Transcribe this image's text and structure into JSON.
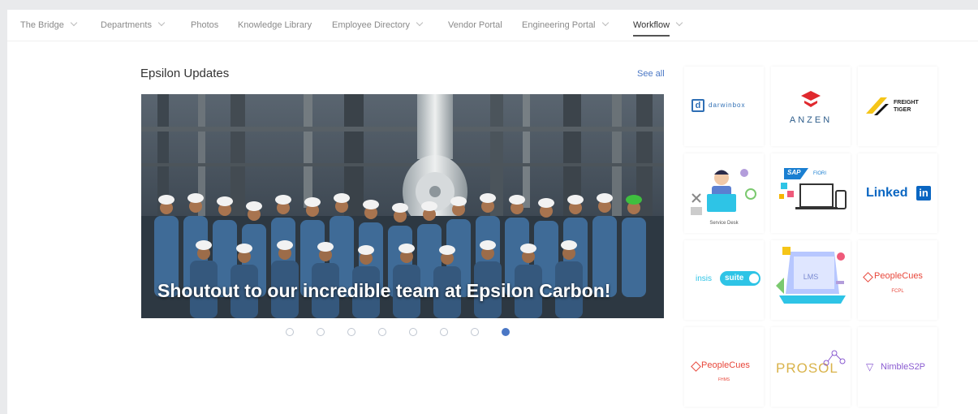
{
  "nav": {
    "items": [
      {
        "label": "The Bridge",
        "dropdown": true
      },
      {
        "label": "Departments",
        "dropdown": true
      },
      {
        "label": "Photos",
        "dropdown": false
      },
      {
        "label": "Knowledge Library",
        "dropdown": false
      },
      {
        "label": "Employee Directory",
        "dropdown": true
      },
      {
        "label": "Vendor Portal",
        "dropdown": false
      },
      {
        "label": "Engineering Portal",
        "dropdown": true
      },
      {
        "label": "Workflow",
        "dropdown": true,
        "active": true
      }
    ]
  },
  "updates": {
    "title": "Epsilon Updates",
    "see_all": "See all",
    "caption": "Shoutout to our incredible team at Epsilon Carbon!",
    "slide_count": 8,
    "active_slide": 8
  },
  "apps": {
    "darwinbox": {
      "mark": "d",
      "name": "darwinbox",
      "color": "#2f6fb5"
    },
    "anzen": {
      "name": "ANZEN",
      "color": "#e0292e"
    },
    "freight_tiger": {
      "line1": "FREIGHT",
      "line2": "TIGER",
      "color": "#f5c518"
    },
    "service_desk": {
      "label": "Service Desk"
    },
    "sap_fiori": {
      "brand": "SAP",
      "product": "FIORI",
      "color": "#1a7fd1"
    },
    "linkedin": {
      "word": "Linked",
      "mark": "in",
      "color": "#0a66c2"
    },
    "insis": {
      "word": "insis",
      "suite": "suite"
    },
    "lms": {
      "label": "LMS"
    },
    "peoplecues_fcpl": {
      "name": "PeopleCues",
      "sub": "FCPL",
      "color": "#e8473b"
    },
    "peoplecues_2": {
      "name": "PeopleCues",
      "sub": "FHMS",
      "color": "#e8473b"
    },
    "prosol": {
      "name": "PROSOL",
      "color": "#d9b34a"
    },
    "nimble": {
      "name": "NimbleS2P",
      "color": "#8a5bd1"
    }
  }
}
